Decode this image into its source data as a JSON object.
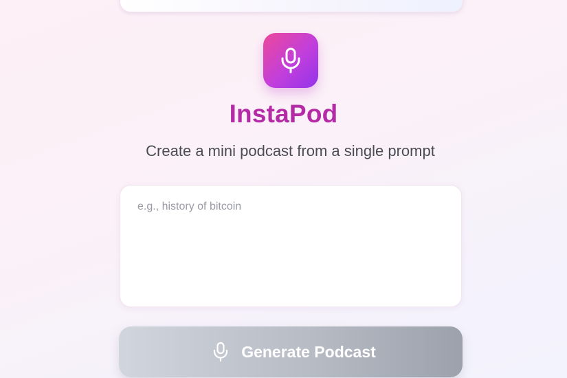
{
  "app": {
    "title": "InstaPod",
    "subtitle": "Create a mini podcast from a single prompt",
    "logo_icon": "microphone-icon"
  },
  "prompt": {
    "placeholder": "e.g., history of bitcoin",
    "value": ""
  },
  "actions": {
    "generate_label": "Generate Podcast",
    "generate_icon": "microphone-icon",
    "generate_enabled": false
  },
  "colors": {
    "brand_gradient_start": "#ec4899",
    "brand_gradient_end": "#9333ea",
    "title_color": "#b42ba6",
    "button_disabled_gradient_start": "#d1d5dc",
    "button_disabled_gradient_end": "#9ca1ab"
  }
}
